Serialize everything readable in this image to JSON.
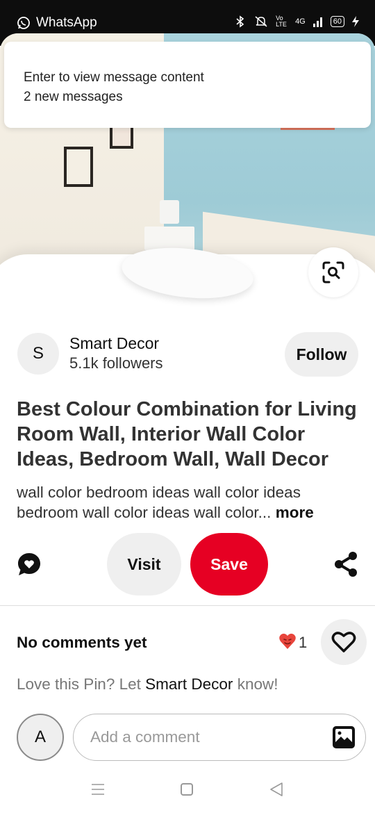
{
  "status_bar": {
    "app_name": "WhatsApp",
    "network_label": "4G",
    "volte_label": "Vo LTE",
    "battery": "60"
  },
  "notification": {
    "line1": "Enter to view message content",
    "line2": "2 new messages"
  },
  "creator": {
    "initial": "S",
    "name": "Smart Decor",
    "followers": "5.1k followers",
    "follow_label": "Follow"
  },
  "pin": {
    "title": "Best Colour Combination for Living Room Wall, Interior Wall Color Ideas, Bedroom Wall, Wall Decor",
    "description": "wall color bedroom ideas wall color ideas bedroom wall color ideas wall color...",
    "more_label": "more"
  },
  "actions": {
    "visit_label": "Visit",
    "save_label": "Save"
  },
  "comments": {
    "heading": "No comments yet",
    "reaction_count": "1",
    "prompt_prefix": "Love this Pin? Let",
    "prompt_name": "Smart Decor",
    "prompt_suffix": "know!",
    "user_initial": "A",
    "input_placeholder": "Add a comment"
  },
  "colors": {
    "save_red": "#e60023",
    "button_gray": "#efefef"
  },
  "icons": [
    "whatsapp-icon",
    "bluetooth-icon",
    "mute-icon",
    "signal-icon",
    "charging-icon",
    "visual-search-icon",
    "comment-bubble-icon",
    "share-icon",
    "heart-emoji-icon",
    "heart-outline-icon",
    "photo-icon",
    "nav-menu-icon",
    "nav-home-icon",
    "nav-back-icon"
  ]
}
